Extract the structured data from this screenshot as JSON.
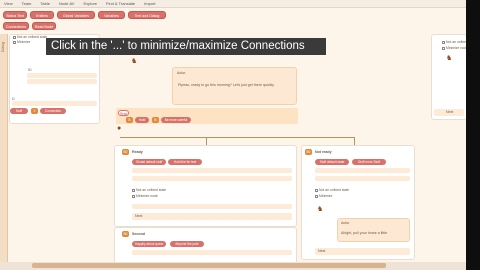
{
  "menu": [
    "View",
    "Team",
    "Table",
    "Node AV",
    "Explore",
    "Find & Translate",
    "Import"
  ],
  "toolbar": {
    "buttons": [
      "Status Text",
      "Entities",
      "Global Variables",
      "Variables",
      "Text and Dialog",
      "Connections",
      "Read Node"
    ]
  },
  "sidebar_label": "Dialog",
  "tutorial_tip": "Click in the '...' to minimize/maximize Connections",
  "left_panel": {
    "chk_top": "Not an unfixed state",
    "chk_top2": "Minimize",
    "field_label": "ID",
    "node_label": "D",
    "pills": [
      "Stuff",
      "Connection"
    ]
  },
  "top_node": {
    "header": "Actor",
    "speech": "Pipeau, ready to go this morning? Let's just get there quickly",
    "choice_labels": [
      "Read",
      "Hold",
      "Be more careful"
    ]
  },
  "ready_node": {
    "badge": "B0",
    "title": "Ready",
    "pills": [
      "Global default stuff",
      "Hold the tin text"
    ],
    "chk1": "Not an unfixed state",
    "chk2": "Minimize node",
    "footer": "Next"
  },
  "not_ready_node": {
    "badge": "B0",
    "title": "Not ready",
    "pills": [
      "Stuff default state",
      "Stuff more Stuff"
    ],
    "chk1": "Not an unfixed state",
    "chk2": "Minimize",
    "speech_header": "Actor",
    "speech": "Alright, pull your horse a little",
    "footer": "Next"
  },
  "second_node": {
    "badge": "B0",
    "title": "Second",
    "pills": [
      "Happily about quest",
      "Beyond the pole"
    ]
  },
  "right_panel": {
    "chk1": "Not an unfixed state",
    "chk2": "Minimize node",
    "footer": "Next"
  }
}
